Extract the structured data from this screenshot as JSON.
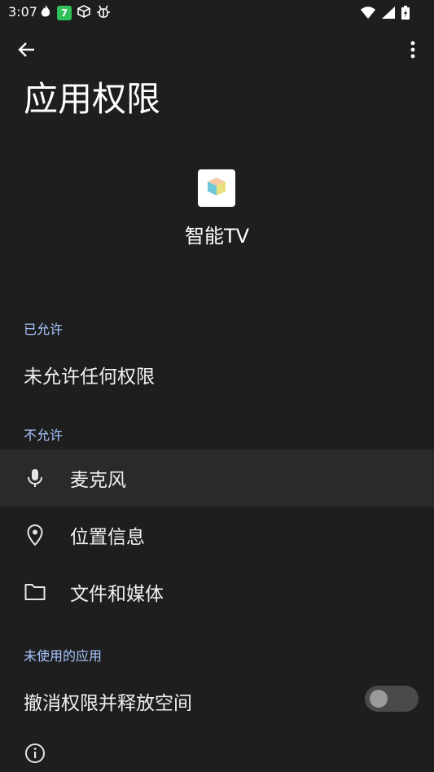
{
  "status": {
    "time": "3:07",
    "left_icons": [
      "fire-icon",
      "green-7-icon",
      "cube-icon",
      "bug-icon"
    ],
    "badge_text": "7",
    "right_icons": [
      "wifi-icon",
      "signal-icon",
      "battery-icon"
    ]
  },
  "topbar": {
    "back_icon": "arrow-left-icon",
    "more_icon": "more-vert-icon"
  },
  "page": {
    "title": "应用权限"
  },
  "app": {
    "name": "智能TV",
    "icon": "cube-app-icon"
  },
  "sections": {
    "allowed_header": "已允许",
    "allowed_empty": "未允许任何权限",
    "denied_header": "不允许",
    "denied_items": [
      {
        "label": "麦克风",
        "icon": "microphone-icon"
      },
      {
        "label": "位置信息",
        "icon": "location-pin-icon"
      },
      {
        "label": "文件和媒体",
        "icon": "folder-icon"
      }
    ],
    "unused_header": "未使用的应用"
  },
  "unused": {
    "toggle_label": "撤消权限并释放空间",
    "toggle_on": false
  },
  "footer": {
    "info_icon": "info-icon"
  },
  "colors": {
    "background": "#1e1e1e",
    "section_header": "#a8c6ff",
    "highlight_row": "#2a2a2a"
  }
}
